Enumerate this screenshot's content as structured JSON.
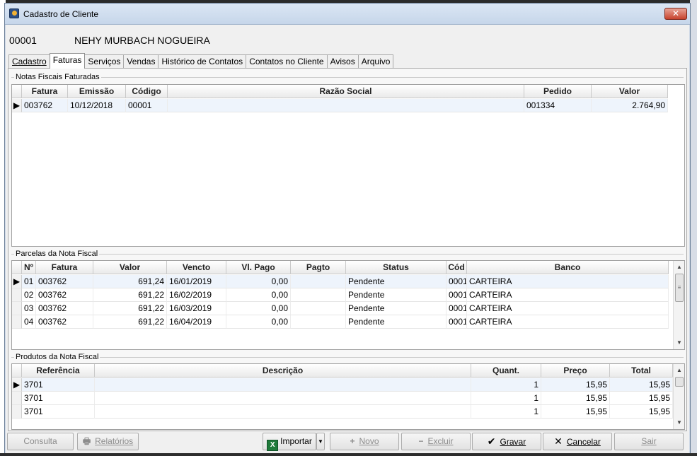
{
  "window": {
    "title": "Cadastro de Cliente",
    "close_glyph": "✕"
  },
  "header": {
    "code": "00001",
    "name": "NEHY MURBACH NOGUEIRA"
  },
  "tabs": [
    {
      "label": "Cadastro"
    },
    {
      "label": "Faturas"
    },
    {
      "label": "Serviços"
    },
    {
      "label": "Vendas"
    },
    {
      "label": "Histórico de Contatos"
    },
    {
      "label": "Contatos no Cliente"
    },
    {
      "label": "Avisos"
    },
    {
      "label": "Arquivo"
    }
  ],
  "notas": {
    "group_label": "Notas Fiscais Faturadas",
    "columns": [
      "Fatura",
      "Emissão",
      "Código",
      "Razão Social",
      "Pedido",
      "Valor"
    ],
    "rows": [
      {
        "fatura": "003762",
        "emissao": "10/12/2018",
        "codigo": "00001",
        "razao": "",
        "pedido": "001334",
        "valor": "2.764,90"
      }
    ]
  },
  "parcelas": {
    "group_label": "Parcelas da Nota Fiscal",
    "columns": [
      "Nº",
      "Fatura",
      "Valor",
      "Vencto",
      "Vl. Pago",
      "Pagto",
      "Status",
      "Cód",
      "Banco"
    ],
    "rows": [
      {
        "n": "01",
        "fatura": "003762",
        "valor": "691,24",
        "vencto": "16/01/2019",
        "vlpago": "0,00",
        "pagto": "",
        "status": "Pendente",
        "cod": "0001",
        "banco": "CARTEIRA"
      },
      {
        "n": "02",
        "fatura": "003762",
        "valor": "691,22",
        "vencto": "16/02/2019",
        "vlpago": "0,00",
        "pagto": "",
        "status": "Pendente",
        "cod": "0001",
        "banco": "CARTEIRA"
      },
      {
        "n": "03",
        "fatura": "003762",
        "valor": "691,22",
        "vencto": "16/03/2019",
        "vlpago": "0,00",
        "pagto": "",
        "status": "Pendente",
        "cod": "0001",
        "banco": "CARTEIRA"
      },
      {
        "n": "04",
        "fatura": "003762",
        "valor": "691,22",
        "vencto": "16/04/2019",
        "vlpago": "0,00",
        "pagto": "",
        "status": "Pendente",
        "cod": "0001",
        "banco": "CARTEIRA"
      }
    ]
  },
  "produtos": {
    "group_label": "Produtos da Nota Fiscal",
    "columns": [
      "Referência",
      "Descrição",
      "Quant.",
      "Preço",
      "Total"
    ],
    "rows": [
      {
        "ref": "3701",
        "desc": "",
        "quant": "1",
        "preco": "15,95",
        "total": "15,95"
      },
      {
        "ref": "3701",
        "desc": "",
        "quant": "1",
        "preco": "15,95",
        "total": "15,95"
      },
      {
        "ref": "3701",
        "desc": "",
        "quant": "1",
        "preco": "15,95",
        "total": "15,95"
      }
    ]
  },
  "buttons": {
    "consulta": "Consulta",
    "relatorios": "Relatórios",
    "importar": "Importar",
    "novo": "Novo",
    "excluir": "Excluir",
    "gravar": "Gravar",
    "cancelar": "Cancelar",
    "sair": "Sair"
  },
  "icons": {
    "row_pointer": "▶",
    "scroll_up": "▲",
    "scroll_down": "▼",
    "novo_glyph": "+",
    "excluir_glyph": "−",
    "gravar_glyph": "✔",
    "cancelar_glyph": "✕",
    "dropdown_glyph": "▼",
    "xls_glyph": "X",
    "relatorios_glyph": "🖶",
    "thumb_grip": "≡"
  },
  "colors": {
    "titlebar": "#c6d6ea",
    "close_button": "#c7432d",
    "selected_row": "#eef4fc",
    "excel_icon": "#1f7a3a"
  }
}
